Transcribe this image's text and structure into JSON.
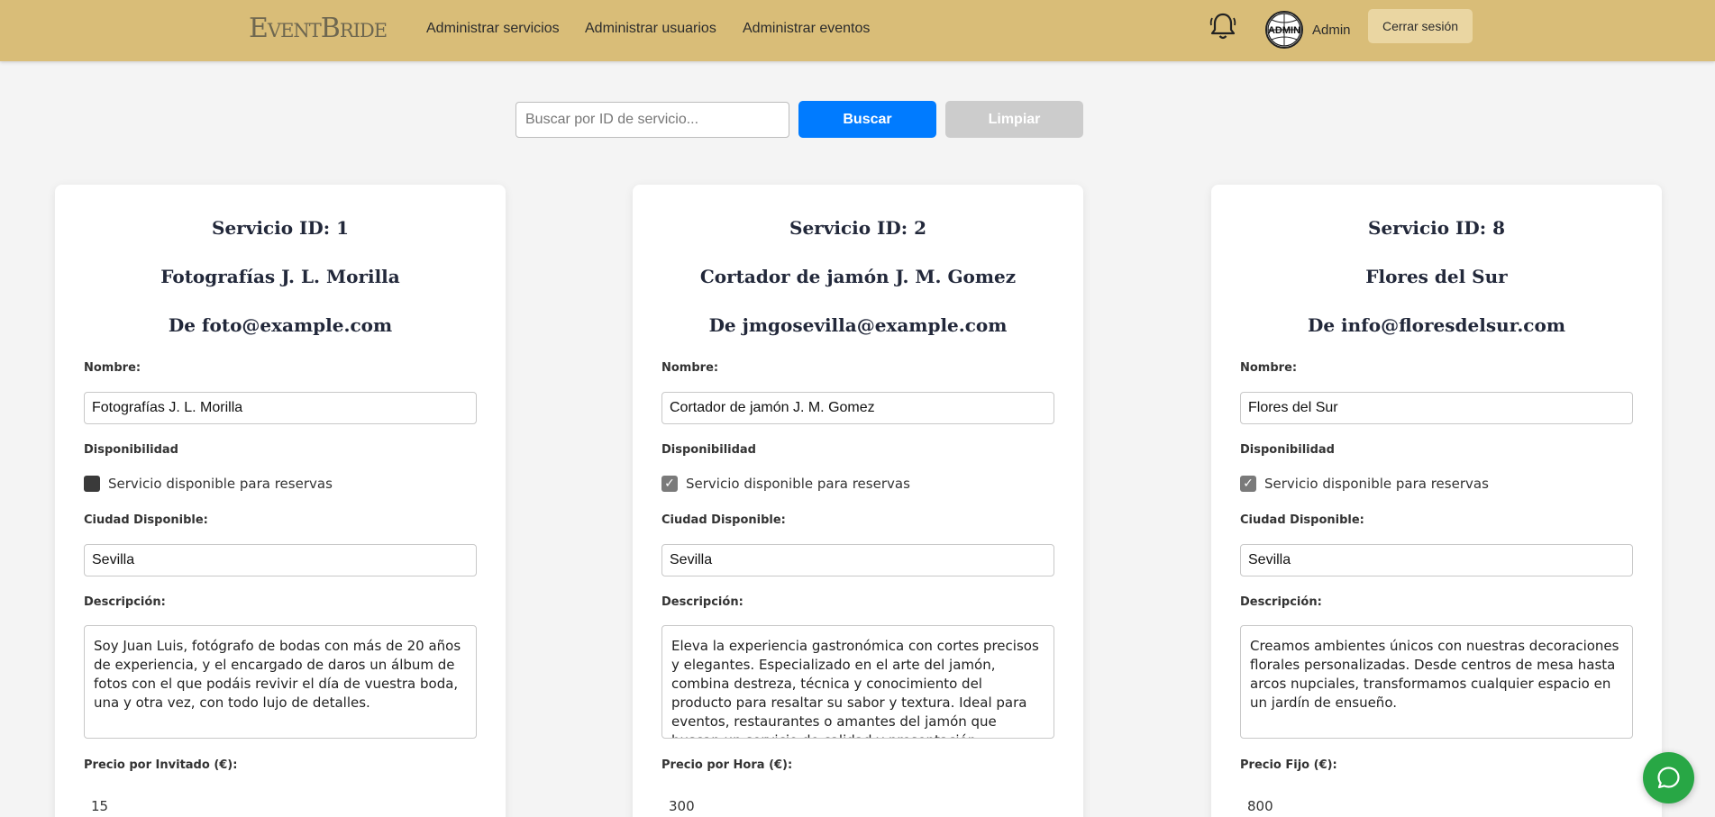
{
  "header": {
    "logo": "EventBride",
    "nav": [
      {
        "label": "Administrar servicios"
      },
      {
        "label": "Administrar usuarios"
      },
      {
        "label": "Administrar eventos"
      }
    ],
    "bell_icon": "bell-icon",
    "avatar_text": "ADMIN",
    "user_label": "Admin",
    "logout_label": "Cerrar sesión"
  },
  "search": {
    "placeholder": "Buscar por ID de servicio...",
    "search_label": "Buscar",
    "clear_label": "Limpiar"
  },
  "cards": [
    {
      "id_title": "Servicio ID: 1",
      "name_title": "Fotografías J. L. Morilla",
      "email_title": "De foto@example.com",
      "nombre_label": "Nombre:",
      "nombre_value": "Fotografías J. L. Morilla",
      "disponibilidad_label": "Disponibilidad",
      "available": false,
      "checkbox_label": "Servicio disponible para reservas",
      "ciudad_label": "Ciudad Disponible:",
      "ciudad_value": "Sevilla",
      "descripcion_label": "Descripción:",
      "descripcion_value": "Soy Juan Luis, fotógrafo de bodas con más de 20 años de experiencia, y el encargado de daros un álbum de fotos con el que podáis revivir el día de vuestra boda, una y otra vez, con todo lujo de detalles.",
      "precio_label": "Precio por Invitado (€):",
      "precio_value": "15"
    },
    {
      "id_title": "Servicio ID: 2",
      "name_title": "Cortador de jamón J. M. Gomez",
      "email_title": "De jmgosevilla@example.com",
      "nombre_label": "Nombre:",
      "nombre_value": "Cortador de jamón J. M. Gomez",
      "disponibilidad_label": "Disponibilidad",
      "available": true,
      "checkbox_label": "Servicio disponible para reservas",
      "ciudad_label": "Ciudad Disponible:",
      "ciudad_value": "Sevilla",
      "descripcion_label": "Descripción:",
      "descripcion_value": "Eleva la experiencia gastronómica con cortes precisos y elegantes. Especializado en el arte del jamón, combina destreza, técnica y conocimiento del producto para resaltar su sabor y textura. Ideal para eventos, restaurantes o amantes del jamón que buscan un servicio de calidad y presentación impecable.",
      "precio_label": "Precio por Hora (€):",
      "precio_value": "300"
    },
    {
      "id_title": "Servicio ID: 8",
      "name_title": "Flores del Sur",
      "email_title": "De info@floresdelsur.com",
      "nombre_label": "Nombre:",
      "nombre_value": "Flores del Sur",
      "disponibilidad_label": "Disponibilidad",
      "available": true,
      "checkbox_label": "Servicio disponible para reservas",
      "ciudad_label": "Ciudad Disponible:",
      "ciudad_value": "Sevilla",
      "descripcion_label": "Descripción:",
      "descripcion_value": "Creamos ambientes únicos con nuestras decoraciones florales personalizadas. Desde centros de mesa hasta arcos nupciales, transformamos cualquier espacio en un jardín de ensueño.",
      "precio_label": "Precio Fijo (€):",
      "precio_value": "800"
    }
  ],
  "chat_icon": "chat-bubble-icon",
  "colors": {
    "header_bg": "#d9bd78",
    "primary": "#007bff",
    "disabled": "#cccccc",
    "chat": "#28a745"
  }
}
